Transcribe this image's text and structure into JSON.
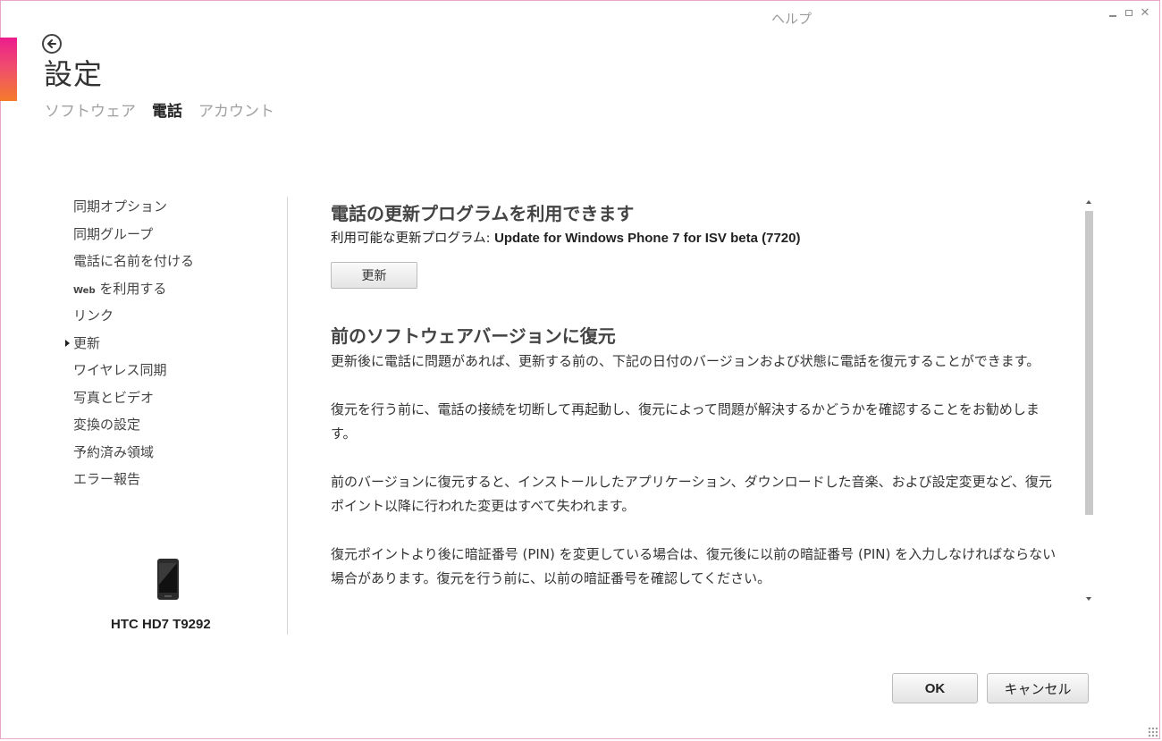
{
  "window": {
    "help_label": "ヘルプ"
  },
  "header": {
    "title": "設定",
    "tabs": [
      {
        "label": "ソフトウェア",
        "active": false
      },
      {
        "label": "電話",
        "active": true
      },
      {
        "label": "アカウント",
        "active": false
      }
    ]
  },
  "sidebar": {
    "items": [
      {
        "label": "同期オプション"
      },
      {
        "label": "同期グループ"
      },
      {
        "label": "電話に名前を付ける"
      },
      {
        "label_prefix": "Web",
        "label": "を利用する"
      },
      {
        "label": "リンク"
      },
      {
        "label": "更新",
        "active": true
      },
      {
        "label": "ワイヤレス同期"
      },
      {
        "label": "写真とビデオ"
      },
      {
        "label": "変換の設定"
      },
      {
        "label": "予約済み領域"
      },
      {
        "label": "エラー報告"
      }
    ],
    "device_name": "HTC HD7 T9292"
  },
  "main": {
    "update_section": {
      "title": "電話の更新プログラムを利用できます",
      "available_label": "利用可能な更新プログラム: ",
      "available_value": "Update for Windows Phone 7 for ISV beta (7720)",
      "button_label": "更新"
    },
    "restore_section": {
      "title": "前のソフトウェアバージョンに復元",
      "paragraphs": [
        "更新後に電話に問題があれば、更新する前の、下記の日付のバージョンおよび状態に電話を復元することができます。",
        "復元を行う前に、電話の接続を切断して再起動し、復元によって問題が解決するかどうかを確認することをお勧めします。",
        "前のバージョンに復元すると、インストールしたアプリケーション、ダウンロードした音楽、および設定変更など、復元ポイント以降に行われた変更はすべて失われます。",
        "復元ポイントより後に暗証番号 (PIN) を変更している場合は、復元後に以前の暗証番号 (PIN) を入力しなければならない場合があります。復元を行う前に、以前の暗証番号を確認してください。"
      ]
    }
  },
  "footer": {
    "ok_label": "OK",
    "cancel_label": "キャンセル"
  },
  "colors": {
    "accent_top": "#ec1c8e",
    "accent_bottom": "#f47b2a"
  }
}
